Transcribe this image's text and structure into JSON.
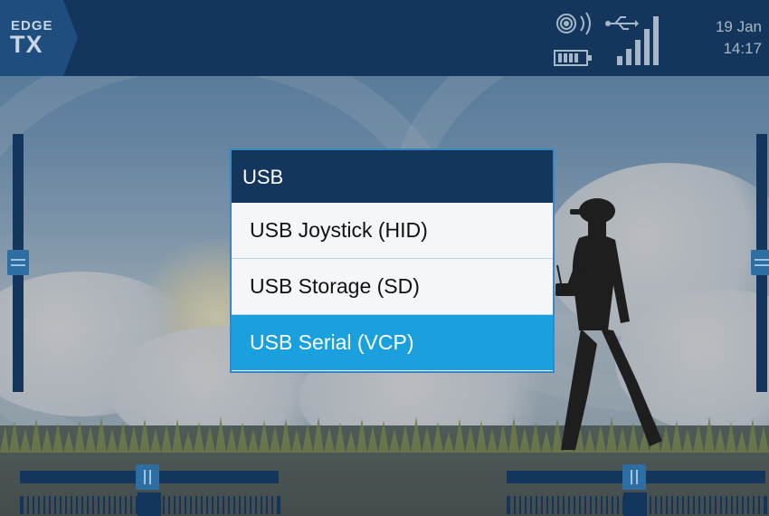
{
  "header": {
    "logo_top": "EDGE",
    "logo_bottom": "TX",
    "date": "19 Jan",
    "time": "14:17",
    "icons": [
      "radio-signal-icon",
      "usb-icon",
      "signal-strength-icon",
      "battery-icon"
    ]
  },
  "popup": {
    "title": "USB",
    "items": [
      {
        "label": "USB Joystick (HID)",
        "selected": false
      },
      {
        "label": "USB Storage (SD)",
        "selected": false
      },
      {
        "label": "USB Serial (VCP)",
        "selected": true
      }
    ]
  },
  "colors": {
    "bar": "#14365c",
    "accent": "#1aa0dc",
    "trim_knob": "#2f6ea3"
  }
}
